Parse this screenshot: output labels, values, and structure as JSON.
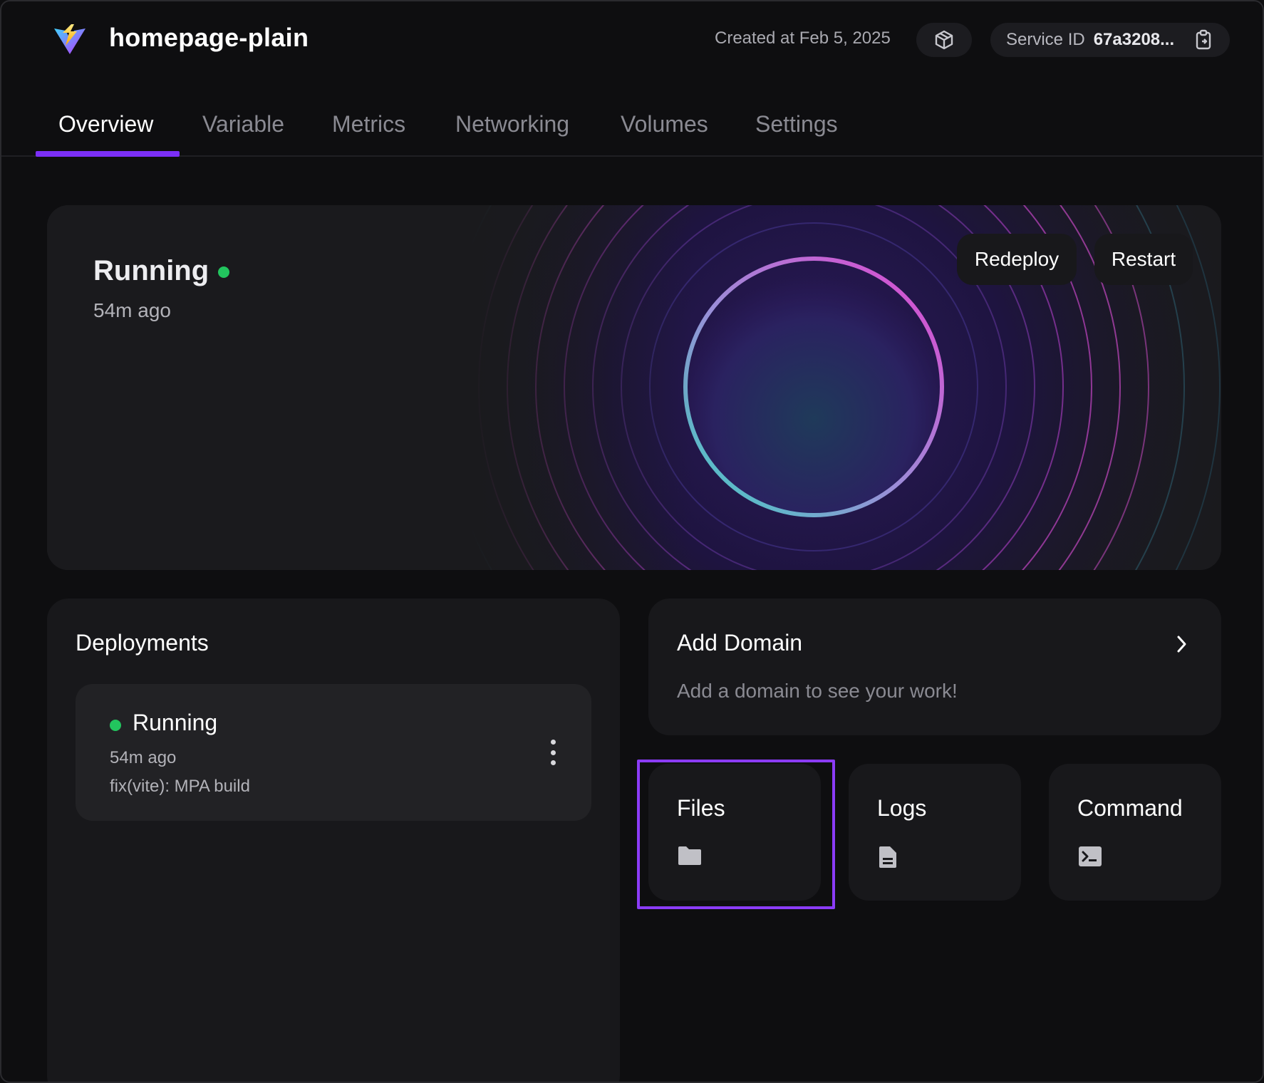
{
  "header": {
    "service_name": "homepage-plain",
    "created": "Created at Feb 5, 2025",
    "service_id_label": "Service ID",
    "service_id_value": "67a3208..."
  },
  "tabs": [
    {
      "label": "Overview",
      "active": true
    },
    {
      "label": "Variable",
      "active": false
    },
    {
      "label": "Metrics",
      "active": false
    },
    {
      "label": "Networking",
      "active": false
    },
    {
      "label": "Volumes",
      "active": false
    },
    {
      "label": "Settings",
      "active": false
    }
  ],
  "hero": {
    "status": "Running",
    "time": "54m ago",
    "redeploy_label": "Redeploy",
    "restart_label": "Restart"
  },
  "deployments": {
    "title": "Deployments",
    "items": [
      {
        "status": "Running",
        "time": "54m ago",
        "commit": "fix(vite): MPA build"
      }
    ]
  },
  "domain": {
    "title": "Add Domain",
    "subtitle": "Add a domain to see your work!"
  },
  "tools": [
    {
      "label": "Files",
      "icon": "folder-icon"
    },
    {
      "label": "Logs",
      "icon": "document-icon"
    },
    {
      "label": "Command",
      "icon": "terminal-icon"
    }
  ],
  "colors": {
    "accent": "#7b2ff7",
    "highlight": "#8b3cf7",
    "status_running": "#22c55e",
    "background": "#0e0e10",
    "card": "#18181b"
  }
}
